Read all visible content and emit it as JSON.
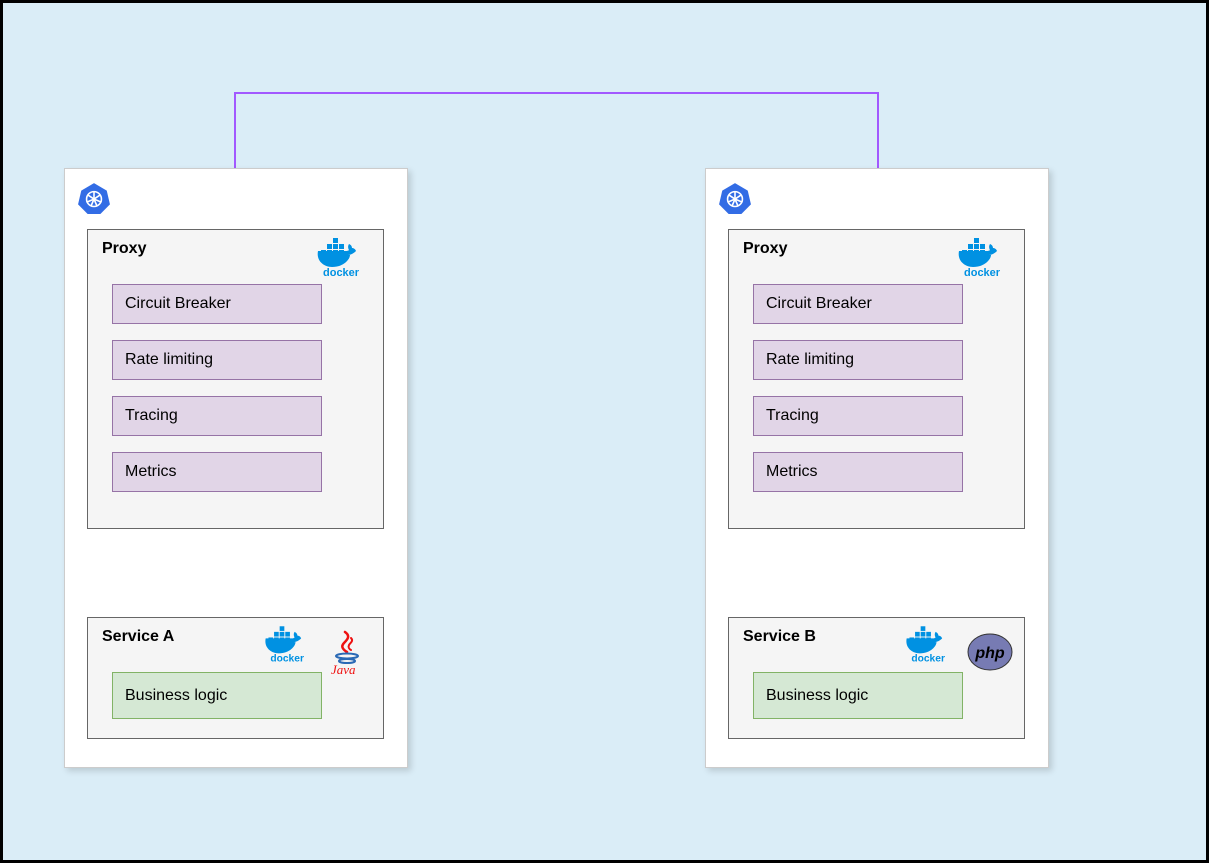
{
  "icons": {
    "kubernetes": "kubernetes-icon",
    "docker_label": "docker"
  },
  "podA": {
    "proxy": {
      "title": "Proxy",
      "features": [
        "Circuit Breaker",
        "Rate limiting",
        "Tracing",
        "Metrics"
      ]
    },
    "service": {
      "title": "Service A",
      "business": "Business logic",
      "language": "Java"
    }
  },
  "podB": {
    "proxy": {
      "title": "Proxy",
      "features": [
        "Circuit Breaker",
        "Rate limiting",
        "Tracing",
        "Metrics"
      ]
    },
    "service": {
      "title": "Service B",
      "business": "Business logic",
      "language": "php"
    }
  },
  "colors": {
    "arrow": "#a259ff",
    "featureFill": "#e1d5e7",
    "featureBorder": "#9673a6",
    "bizFill": "#d5e8d4",
    "bizBorder": "#82b366"
  }
}
